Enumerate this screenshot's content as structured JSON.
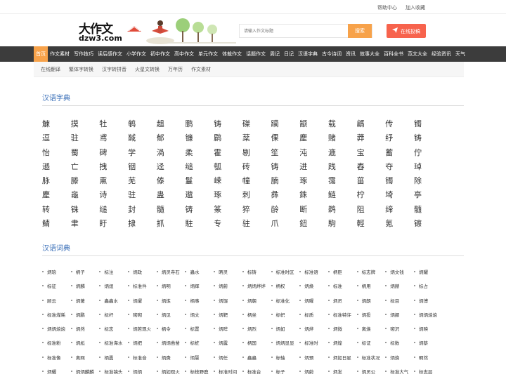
{
  "top_links": [
    "帮助中心",
    "加入收藏"
  ],
  "logo": {
    "big": "大作文",
    "domain": "dzw3.com"
  },
  "search": {
    "placeholder": "请输入作文标题",
    "button": "搜索"
  },
  "submit_label": "在线投稿",
  "nav": [
    "首页",
    "作文素材",
    "写作技巧",
    "读后感作文",
    "小学作文",
    "初中作文",
    "高中作文",
    "单元作文",
    "体裁作文",
    "话题作文",
    "周记",
    "日记",
    "汉语字典",
    "古今诗词",
    "资讯",
    "故事大全",
    "百科全书",
    "范文大全",
    "经验资讯",
    "天气"
  ],
  "subnav": [
    "在线翻译",
    "繁体字转换",
    "汉字转拼音",
    "火星文转换",
    "万年历",
    "作文素材"
  ],
  "zidian": {
    "title": "汉语字典",
    "chars": [
      "觫",
      "摸",
      "牡",
      "鹌",
      "趄",
      "鹏",
      "铸",
      "磔",
      "躏",
      "颛",
      "载",
      "騗",
      "传",
      "镯",
      "逗",
      "驻",
      "鸢",
      "馘",
      "郁",
      "镰",
      "鹛",
      "棻",
      "倮",
      "麈",
      "赌",
      "莽",
      "纾",
      "铸",
      "怡",
      "蜀",
      "碑",
      "学",
      "渦",
      "柔",
      "霍",
      "剔",
      "笙",
      "沌",
      "漉",
      "宝",
      "蓄",
      "佇",
      "遜",
      "亡",
      "拽",
      "铟",
      "迳",
      "缒",
      "瓠",
      "砖",
      "铸",
      "进",
      "践",
      "舂",
      "夺",
      "琸",
      "脉",
      "滕",
      "熏",
      "芜",
      "傣",
      "鬘",
      "嵘",
      "幢",
      "腩",
      "琢",
      "霭",
      "菑",
      "镯",
      "除",
      "麈",
      "龜",
      "诗",
      "驻",
      "蛊",
      "邈",
      "琢",
      "刺",
      "彝",
      "銖",
      "鲢",
      "柠",
      "埼",
      "亭",
      "转",
      "铢",
      "缒",
      "封",
      "髓",
      "铸",
      "篆",
      "猝",
      "龄",
      "断",
      "鹈",
      "阻",
      "缔",
      "髓",
      "鲭",
      "聿",
      "盱",
      "捸",
      "抓",
      "駐",
      "专",
      "驻",
      "爪",
      "鈕",
      "駒",
      "輕",
      "氪",
      "镲"
    ]
  },
  "cidian": {
    "title": "汉语词典",
    "words": [
      "炳琅",
      "柄子",
      "标注",
      "炳政",
      "炳灵寺石",
      "蟲水",
      "昞灵",
      "标铸",
      "标准时区",
      "标准语",
      "柄臣",
      "标志牌",
      "炳文钱",
      "炳耀",
      "标征",
      "炳麟",
      "炳烜",
      "标准件",
      "炳明",
      "炳辉",
      "炳蔚",
      "炳炳烨烨",
      "柄权",
      "炳焕",
      "标准",
      "柄用",
      "炳赫",
      "标占",
      "顾云",
      "炳著",
      "蟲蟲水",
      "炳燿",
      "炳炼",
      "柄事",
      "炳馄",
      "炳朝",
      "标准化",
      "炳曜",
      "炳灵",
      "炳朗",
      "标目",
      "炳博",
      "标准煤耗",
      "炳鹏",
      "标杆",
      "砌砌",
      "炳见",
      "炳文",
      "炳靶",
      "柄坐",
      "标帜",
      "标质",
      "标准特许",
      "炳投",
      "炳挪",
      "炳炳烺烺",
      "炳炳烺烺",
      "炳然",
      "标志",
      "炳若观火",
      "柄令",
      "标置",
      "炳晔",
      "炳烈",
      "炳如",
      "炳烨",
      "炳微",
      "离焕",
      "砌沢",
      "炳映",
      "标准粉",
      "炳彪",
      "标准海水",
      "炳把",
      "炳炳凿凿",
      "标桩",
      "炳露",
      "柄国",
      "炳炳显显",
      "标准时",
      "炳煌",
      "标证",
      "标数",
      "炳蔡",
      "标准像",
      "离网",
      "柄蠹",
      "标准音",
      "炳赉",
      "炳慧",
      "炳任",
      "蟲蟲",
      "标轴",
      "炳预",
      "炳如日星",
      "标准状况",
      "炳焕",
      "昞然",
      "炳耀",
      "炳炳麟麟",
      "标准镜头",
      "炳炳",
      "炳如观火",
      "标枝野鹿",
      "标准时间",
      "标准台",
      "标子",
      "炳蔚",
      "炳发",
      "炳灵公",
      "标准大气",
      "标志层"
    ]
  }
}
